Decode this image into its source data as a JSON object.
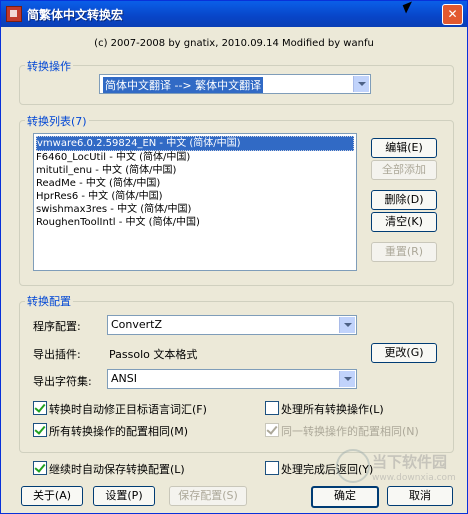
{
  "window": {
    "title": "简繁体中文转换宏",
    "close_glyph": "✕"
  },
  "credit": "(c) 2007-2008 by gnatix, 2010.09.14 Modified by wanfu",
  "conversion_op": {
    "label": "转换操作",
    "selected": "简体中文翻译 --> 繁体中文翻译"
  },
  "conversion_list": {
    "label": "转换列表(7)",
    "items": [
      "vmware6.0.2.59824_EN - 中文 (简体/中国)",
      "F6460_LocUtil - 中文 (简体/中国)",
      "mitutil_enu - 中文 (简体/中国)",
      "ReadMe - 中文 (简体/中国)",
      "HprRes6 - 中文 (简体/中国)",
      "swishmax3res - 中文 (简体/中国)",
      "RoughenToolIntl - 中文 (简体/中国)"
    ],
    "buttons": {
      "edit": "编辑(E)",
      "add_all": "全部添加",
      "delete": "删除(D)",
      "clear": "清空(K)",
      "reset": "重置(R)"
    }
  },
  "config": {
    "label": "转换配置",
    "program_label": "程序配置:",
    "program_value": "ConvertZ",
    "export_plugin_label": "导出插件:",
    "export_plugin_value": "Passolo 文本格式",
    "change_button": "更改(G)",
    "charset_label": "导出字符集:",
    "charset_value": "ANSI"
  },
  "options": {
    "auto_fix": {
      "label": "转换时自动修正目标语言词汇(F)",
      "checked": true
    },
    "process_all": {
      "label": "处理所有转换操作(L)",
      "checked": false
    },
    "same_config": {
      "label": "所有转换操作的配置相同(M)",
      "checked": true
    },
    "same_op_config": {
      "label": "同一转换操作的配置相同(N)",
      "checked": true,
      "disabled": true
    },
    "auto_save": {
      "label": "继续时自动保存转换配置(L)",
      "checked": true
    },
    "return_after": {
      "label": "处理完成后返回(Y)",
      "checked": false
    }
  },
  "bottom": {
    "about": "关于(A)",
    "settings": "设置(P)",
    "save_config": "保存配置(S)",
    "ok": "确定",
    "cancel": "取消"
  },
  "watermark": {
    "name": "当下软件园",
    "url": "www.downxia.com"
  }
}
